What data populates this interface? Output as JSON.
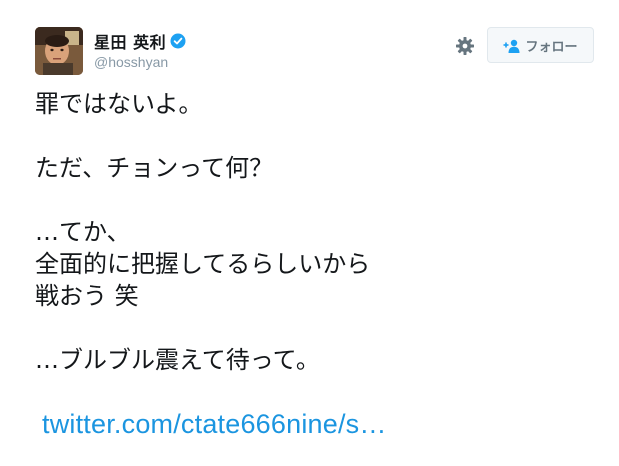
{
  "user": {
    "display_name": "星田 英利",
    "handle": "@hosshyan",
    "verified": true
  },
  "actions": {
    "settings_icon": "gear-icon",
    "follow_label": "フォロー",
    "follow_icon": "add-user-icon"
  },
  "tweet": {
    "lines": [
      "罪ではないよ。",
      "",
      "ただ、チョンって何？",
      "",
      "…てか、",
      "全面的に把握してるらしいから",
      "戦おう 笑",
      "",
      "…ブルブル震えて待って。",
      ""
    ],
    "link_text": "twitter.com/ctate666nine/s…"
  },
  "colors": {
    "link": "#1b95e0",
    "verified": "#1da1f2",
    "handle": "#8899a6",
    "button_border": "#e1e8ed"
  }
}
